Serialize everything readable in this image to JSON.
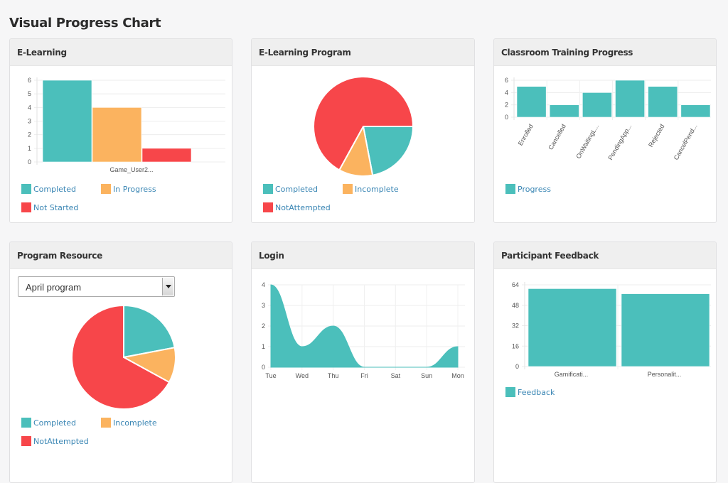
{
  "page": {
    "title": "Visual Progress Chart"
  },
  "colors": {
    "teal": "#4bbfbb",
    "orange": "#fbb35f",
    "red": "#f7464a"
  },
  "panels": {
    "elearning": {
      "title": "E-Learning"
    },
    "elearning_program": {
      "title": "E-Learning Program"
    },
    "classroom": {
      "title": "Classroom Training Progress"
    },
    "program_resource": {
      "title": "Program Resource",
      "select_value": "April program"
    },
    "login": {
      "title": "Login"
    },
    "feedback": {
      "title": "Participant Feedback"
    }
  },
  "chart_data": [
    {
      "id": "elearning",
      "type": "bar",
      "title": "E-Learning",
      "categories": [
        "Game_User2..."
      ],
      "series": [
        {
          "name": "Completed",
          "values": [
            6
          ],
          "color": "#4bbfbb"
        },
        {
          "name": "In Progress",
          "values": [
            4
          ],
          "color": "#fbb35f"
        },
        {
          "name": "Not Started",
          "values": [
            1
          ],
          "color": "#f7464a"
        }
      ],
      "yticks": [
        "0",
        "1",
        "2",
        "3",
        "4",
        "5",
        "6"
      ],
      "ylim": [
        0,
        6
      ],
      "grid": true,
      "legend": "bottom"
    },
    {
      "id": "elearning_program",
      "type": "pie",
      "title": "E-Learning Program",
      "start": "3-o-clock",
      "slices": [
        {
          "name": "Completed",
          "value": 22,
          "color": "#4bbfbb"
        },
        {
          "name": "Incomplete",
          "value": 11,
          "color": "#fbb35f"
        },
        {
          "name": "NotAttempted",
          "value": 67,
          "color": "#f7464a"
        }
      ],
      "legend": "bottom"
    },
    {
      "id": "classroom",
      "type": "bar",
      "title": "Classroom Training Progress",
      "categories": [
        "Enrolled",
        "Cancelled",
        "OnWaitingL...",
        "PendingApp...",
        "Rejected",
        "CancelPend..."
      ],
      "series": [
        {
          "name": "Progress",
          "values": [
            5,
            2,
            4,
            6,
            5,
            2
          ],
          "color": "#4bbfbb"
        }
      ],
      "yticks": [
        "0",
        "2",
        "4",
        "6"
      ],
      "ylim": [
        0,
        6
      ],
      "grid": true,
      "legend": "bottom"
    },
    {
      "id": "program_resource",
      "type": "pie",
      "title": "Program Resource",
      "start": "12-o-clock",
      "slices": [
        {
          "name": "Completed",
          "value": 22,
          "color": "#4bbfbb"
        },
        {
          "name": "Incomplete",
          "value": 11,
          "color": "#fbb35f"
        },
        {
          "name": "NotAttempted",
          "value": 67,
          "color": "#f7464a"
        }
      ],
      "legend": "bottom"
    },
    {
      "id": "login",
      "type": "area",
      "title": "Login",
      "categories": [
        "Tue",
        "Wed",
        "Thu",
        "Fri",
        "Sat",
        "Sun",
        "Mon"
      ],
      "series": [
        {
          "name": "Login",
          "values": [
            4,
            1,
            2,
            0,
            0,
            0,
            1
          ],
          "color": "#4bbfbb"
        }
      ],
      "yticks": [
        "0",
        "1",
        "2",
        "3",
        "4"
      ],
      "ylim": [
        0,
        4
      ],
      "grid": true
    },
    {
      "id": "feedback",
      "type": "bar",
      "title": "Participant Feedback",
      "categories": [
        "Gamificati...",
        "Personalit..."
      ],
      "series": [
        {
          "name": "Feedback",
          "values": [
            61,
            57
          ],
          "color": "#4bbfbb"
        }
      ],
      "yticks": [
        "0",
        "16",
        "32",
        "48",
        "64"
      ],
      "ylim": [
        0,
        64
      ],
      "grid": true,
      "legend": "bottom"
    }
  ]
}
